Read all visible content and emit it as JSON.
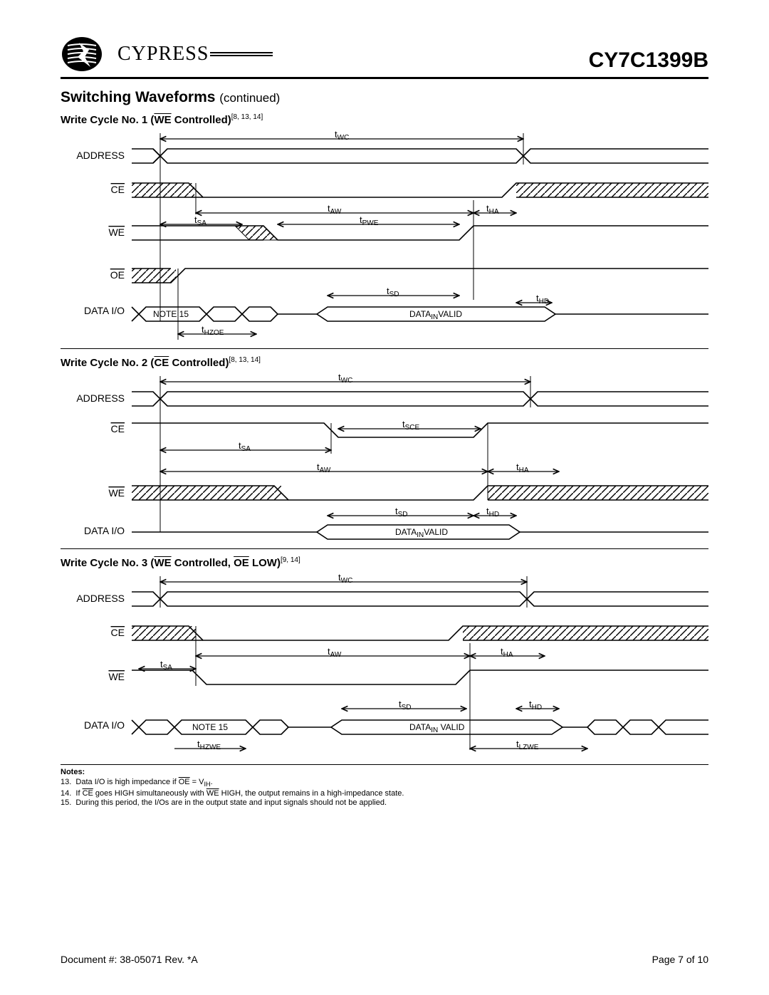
{
  "header": {
    "brand": "CYPRESS",
    "part_number": "CY7C1399B"
  },
  "section": {
    "title": "Switching Waveforms",
    "continued": "(continued)"
  },
  "diagrams": [
    {
      "title_prefix": "Write Cycle No. 1 (",
      "title_ctrl": "WE",
      "title_suffix": " Controlled)",
      "refs": "[8, 13, 14]",
      "signals": {
        "addr": "ADDRESS",
        "ce": "CE",
        "we": "WE",
        "oe": "OE",
        "dio": "DATA I/O"
      },
      "timing": {
        "twc": "t",
        "twc_sub": "WC",
        "taw": "t",
        "taw_sub": "AW",
        "tha": "t",
        "tha_sub": "HA",
        "tsa": "t",
        "tsa_sub": "SA",
        "tpwe": "t",
        "tpwe_sub": "PWE",
        "tsd": "t",
        "tsd_sub": "SD",
        "thd": "t",
        "thd_sub": "HD",
        "thzoe": "t",
        "thzoe_sub": "HZOE"
      },
      "note15": "NOTE 15",
      "data_valid": "DATA",
      "data_valid_sub": "IN",
      "data_valid_suffix": "VALID"
    },
    {
      "title_prefix": "Write Cycle No. 2 (",
      "title_ctrl": "CE",
      "title_suffix": " Controlled)",
      "refs": "[8, 13, 14]",
      "signals": {
        "addr": "ADDRESS",
        "ce": "CE",
        "we": "WE",
        "dio": "DATA I/O"
      },
      "timing": {
        "twc": "t",
        "twc_sub": "WC",
        "tsce": "t",
        "tsce_sub": "SCE",
        "tsa": "t",
        "tsa_sub": "SA",
        "taw": "t",
        "taw_sub": "AW",
        "tha": "t",
        "tha_sub": "HA",
        "tsd": "t",
        "tsd_sub": "SD",
        "thd": "t",
        "thd_sub": "HD"
      },
      "data_valid": "DATA",
      "data_valid_sub": "IN",
      "data_valid_suffix": "VALID"
    },
    {
      "title_prefix": "Write Cycle No. 3 (",
      "title_ctrl": "WE",
      "title_mid": " Controlled, ",
      "title_ctrl2": "OE",
      "title_suffix": " LOW)",
      "refs": "[9, 14]",
      "signals": {
        "addr": "ADDRESS",
        "ce": "CE",
        "we": "WE",
        "dio": "DATA I/O"
      },
      "timing": {
        "twc": "t",
        "twc_sub": "WC",
        "taw": "t",
        "taw_sub": "AW",
        "tha": "t",
        "tha_sub": "HA",
        "tsa": "t",
        "tsa_sub": "SA",
        "tsd": "t",
        "tsd_sub": "SD",
        "thd": "t",
        "thd_sub": "HD",
        "thzwe": "t",
        "thzwe_sub": "HZWE",
        "tlzwe": "t",
        "tlzwe_sub": "LZWE"
      },
      "note15": "NOTE 15",
      "data_valid": "DATA",
      "data_valid_sub": "IN",
      "data_valid_suffix": " VALID"
    }
  ],
  "notes": {
    "heading": "Notes:",
    "items": [
      {
        "num": "13.",
        "pre": "Data I/O is high impedance if ",
        "ov1": "OE",
        "mid": " = V",
        "sub": "IH",
        "suf": "."
      },
      {
        "num": "14.",
        "pre": "If ",
        "ov1": "CE",
        "mid": " goes HIGH simultaneously with ",
        "ov2": "WE",
        "suf": " HIGH, the output remains in a high-impedance state."
      },
      {
        "num": "15.",
        "text": "During this period, the I/Os are in the output state and input signals should not be applied."
      }
    ]
  },
  "footer": {
    "doc": "Document #: 38-05071 Rev. *A",
    "page": "Page 7 of 10"
  }
}
